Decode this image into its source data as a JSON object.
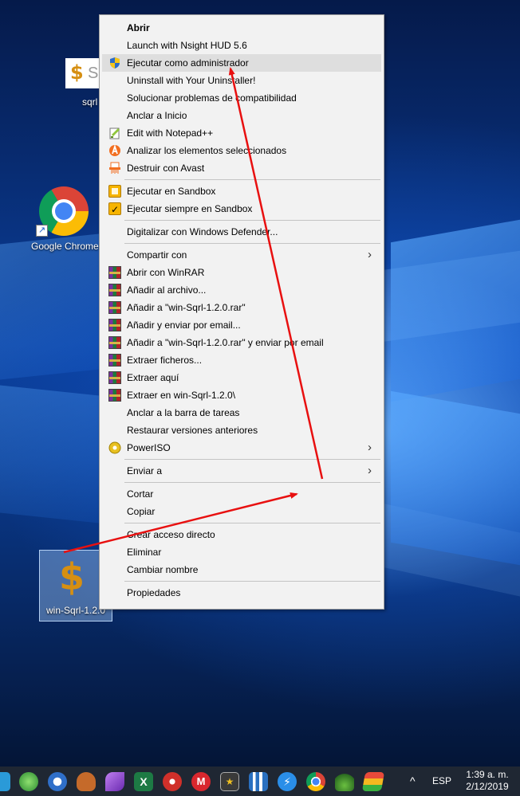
{
  "desktop": {
    "icons": [
      {
        "id": "sqrl",
        "label": "sqrl",
        "logo_text": "So"
      },
      {
        "id": "chrome",
        "label": "Google Chrome"
      },
      {
        "id": "win-sqrl",
        "label": "win-Sqrl-1.2.0"
      }
    ]
  },
  "context_menu": {
    "items": [
      {
        "label": "Abrir",
        "bold": true,
        "icon": ""
      },
      {
        "label": "Launch with Nsight HUD 5.6",
        "icon": ""
      },
      {
        "label": "Ejecutar como administrador",
        "icon": "uac-shield-icon",
        "highlighted": true
      },
      {
        "label": "Uninstall with Your Uninstaller!",
        "icon": ""
      },
      {
        "label": "Solucionar problemas de compatibilidad",
        "icon": ""
      },
      {
        "label": "Anclar a Inicio",
        "icon": ""
      },
      {
        "label": "Edit with Notepad++",
        "icon": "notepadpp-icon"
      },
      {
        "label": "Analizar los elementos seleccionados",
        "icon": "avast-icon"
      },
      {
        "label": "Destruir con Avast",
        "icon": "shredder-icon"
      },
      {
        "label": "Ejecutar en Sandbox",
        "icon": "sandbox-icon"
      },
      {
        "label": "Ejecutar siempre en Sandbox",
        "icon": "sandbox-check-icon"
      },
      {
        "label": "Digitalizar con Windows Defender...",
        "icon": ""
      },
      {
        "label": "Compartir con",
        "icon": "",
        "submenu": true
      },
      {
        "label": "Abrir con WinRAR",
        "icon": "winrar-icon"
      },
      {
        "label": "Añadir al archivo...",
        "icon": "winrar-icon"
      },
      {
        "label": "Añadir a \"win-Sqrl-1.2.0.rar\"",
        "icon": "winrar-icon"
      },
      {
        "label": "Añadir y enviar por email...",
        "icon": "winrar-icon"
      },
      {
        "label": "Añadir a \"win-Sqrl-1.2.0.rar\" y enviar por email",
        "icon": "winrar-icon"
      },
      {
        "label": "Extraer ficheros...",
        "icon": "winrar-icon"
      },
      {
        "label": "Extraer aquí",
        "icon": "winrar-icon"
      },
      {
        "label": "Extraer en win-Sqrl-1.2.0\\",
        "icon": "winrar-icon"
      },
      {
        "label": "Anclar a la barra de tareas",
        "icon": ""
      },
      {
        "label": "Restaurar versiones anteriores",
        "icon": ""
      },
      {
        "label": "PowerISO",
        "icon": "poweriso-icon",
        "submenu": true
      },
      {
        "label": "Enviar a",
        "icon": "",
        "submenu": true
      },
      {
        "label": "Cortar",
        "icon": ""
      },
      {
        "label": "Copiar",
        "icon": ""
      },
      {
        "label": "Crear acceso directo",
        "icon": ""
      },
      {
        "label": "Eliminar",
        "icon": ""
      },
      {
        "label": "Cambiar nombre",
        "icon": ""
      },
      {
        "label": "Propiedades",
        "icon": ""
      }
    ],
    "submenu_glyph": "›"
  },
  "taskbar": {
    "apps": [
      "start-partial-icon",
      "network-globe-icon",
      "windows-media-icon",
      "baseball-glove-icon",
      "feather-icon",
      "excel-icon",
      "ccleaner-icon",
      "mega-icon",
      "terminal-star-icon",
      "bar-chart-icon",
      "lightning-icon",
      "chrome-icon",
      "plant-icon",
      "bluestacks-icon"
    ],
    "tray": {
      "chevron": "^",
      "language": "ESP"
    },
    "clock": {
      "time": "1:39 a. m.",
      "date": "2/12/2019"
    }
  },
  "colors": {
    "annotation_arrow": "#e81010",
    "menu_bg": "#f2f2f2",
    "menu_highlight": "#dedede"
  }
}
